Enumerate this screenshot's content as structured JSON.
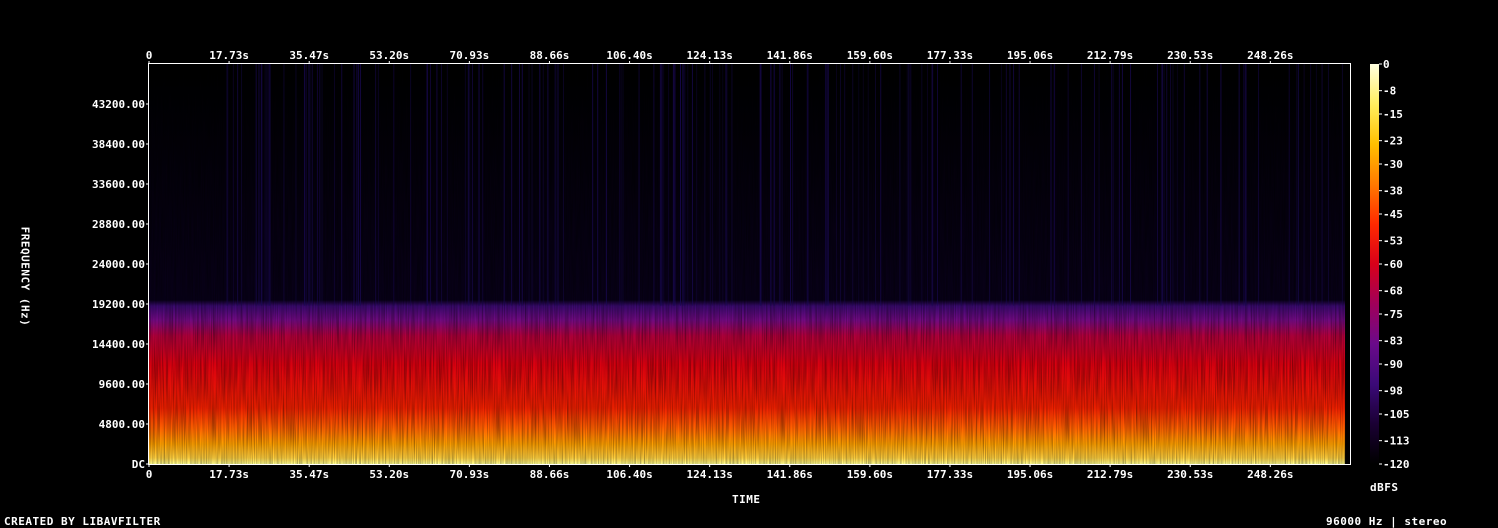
{
  "chart_data": {
    "type": "heatmap",
    "title": "",
    "xlabel": "TIME",
    "ylabel": "FREQUENCY (Hz)",
    "colorbar_label": "dBFS",
    "x_ticks": [
      "0",
      "17.73s",
      "35.47s",
      "53.20s",
      "70.93s",
      "88.66s",
      "106.40s",
      "124.13s",
      "141.86s",
      "159.60s",
      "177.33s",
      "195.06s",
      "212.79s",
      "230.53s",
      "248.26s"
    ],
    "x_tick_values": [
      0,
      17.73,
      35.47,
      53.2,
      70.93,
      88.66,
      106.4,
      124.13,
      141.86,
      159.6,
      177.33,
      195.06,
      212.79,
      230.53,
      248.26
    ],
    "xlim": [
      0,
      265.9
    ],
    "y_ticks": [
      "DC",
      "4800.00",
      "9600.00",
      "14400.00",
      "19200.00",
      "24000.00",
      "28800.00",
      "33600.00",
      "38400.00",
      "43200.00"
    ],
    "y_tick_values": [
      0,
      4800,
      9600,
      14400,
      19200,
      24000,
      28800,
      33600,
      38400,
      43200
    ],
    "ylim": [
      0,
      48000
    ],
    "colorbar_ticks": [
      "0",
      "-8",
      "-15",
      "-23",
      "-30",
      "-38",
      "-45",
      "-53",
      "-60",
      "-68",
      "-75",
      "-83",
      "-90",
      "-98",
      "-105",
      "-113",
      "-120"
    ],
    "colorbar_range": [
      -120,
      0
    ],
    "colormap": [
      "#000000",
      "#1a0033",
      "#3b0a78",
      "#6a0a8a",
      "#a0005a",
      "#d8001a",
      "#ff2a00",
      "#ff7a00",
      "#ffc000",
      "#ffee60",
      "#ffffe0"
    ],
    "content_bands": [
      {
        "freq_range_hz": [
          0,
          1200
        ],
        "level_dbfs": -20
      },
      {
        "freq_range_hz": [
          1200,
          5000
        ],
        "level_dbfs": -38
      },
      {
        "freq_range_hz": [
          5000,
          16000
        ],
        "level_dbfs": -52
      },
      {
        "freq_range_hz": [
          16000,
          19000
        ],
        "level_dbfs": -85
      },
      {
        "freq_range_hz": [
          19000,
          48000
        ],
        "level_dbfs": -115
      }
    ]
  },
  "footer": {
    "created_by": "CREATED BY LIBAVFILTER",
    "sample_info": "96000 Hz | stereo"
  }
}
